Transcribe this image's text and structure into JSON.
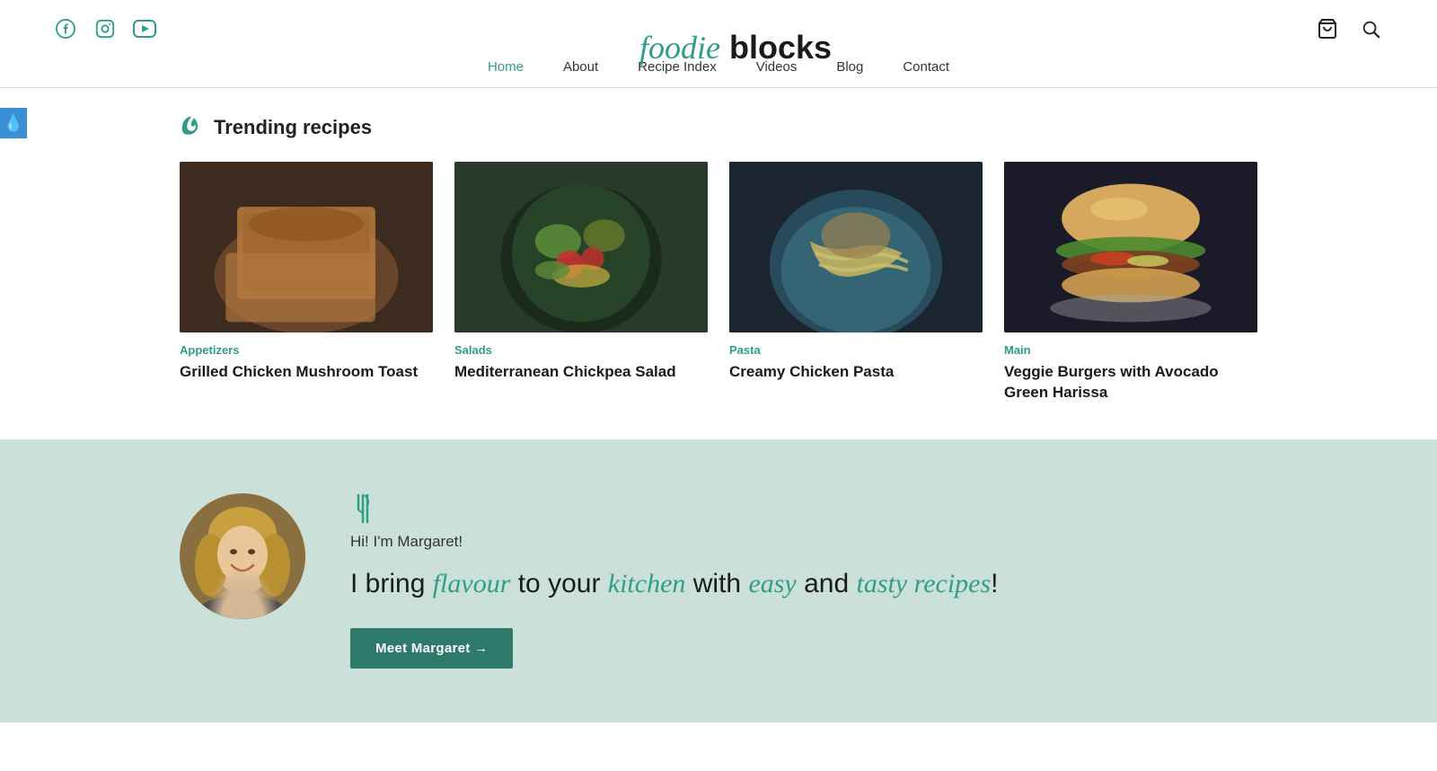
{
  "site": {
    "logo_foodie": "foodie",
    "logo_blocks": " blocks"
  },
  "header": {
    "social": [
      {
        "name": "facebook",
        "label": "Facebook"
      },
      {
        "name": "instagram",
        "label": "Instagram"
      },
      {
        "name": "youtube",
        "label": "YouTube"
      }
    ],
    "icons": [
      {
        "name": "cart",
        "label": "Cart"
      },
      {
        "name": "search",
        "label": "Search"
      }
    ]
  },
  "nav": {
    "items": [
      {
        "label": "Home",
        "active": true
      },
      {
        "label": "About",
        "active": false
      },
      {
        "label": "Recipe Index",
        "active": false
      },
      {
        "label": "Videos",
        "active": false
      },
      {
        "label": "Blog",
        "active": false
      },
      {
        "label": "Contact",
        "active": false
      }
    ]
  },
  "left_badge": {
    "icon": "💧"
  },
  "trending": {
    "title": "Trending recipes",
    "recipes": [
      {
        "category": "Appetizers",
        "title": "Grilled Chicken Mushroom Toast",
        "img_class": "img-toast"
      },
      {
        "category": "Salads",
        "title": "Mediterranean Chickpea Salad",
        "img_class": "img-salad"
      },
      {
        "category": "Pasta",
        "title": "Creamy Chicken Pasta",
        "img_class": "img-pasta"
      },
      {
        "category": "Main",
        "title": "Veggie Burgers with Avocado Green Harissa",
        "img_class": "img-burger"
      }
    ]
  },
  "about": {
    "greeting": "Hi! I'm Margaret!",
    "tagline_plain1": "I bring ",
    "tagline_italic1": "flavour",
    "tagline_plain2": " to your ",
    "tagline_italic2": "kitchen",
    "tagline_plain3": " with ",
    "tagline_italic3": "easy",
    "tagline_plain4": " and ",
    "tagline_italic4": "tasty recipes",
    "tagline_end": "!",
    "button_label": "Meet Margaret →"
  }
}
